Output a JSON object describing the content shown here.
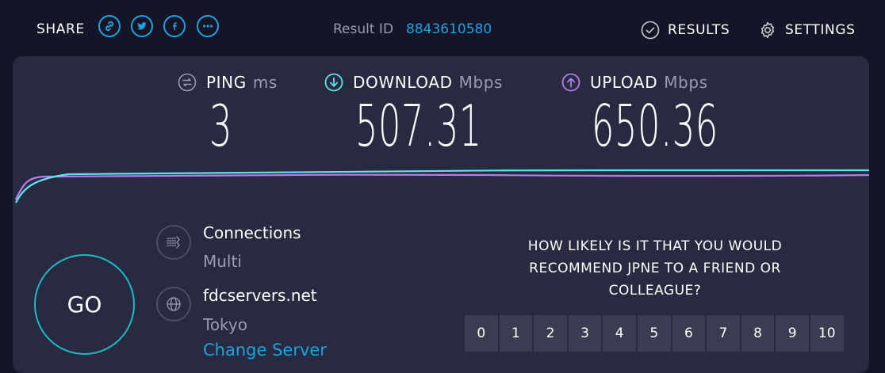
{
  "header": {
    "share_label": "SHARE",
    "share_icons": [
      "link-icon",
      "twitter-icon",
      "facebook-icon",
      "more-icon"
    ],
    "result_label": "Result ID",
    "result_id": "8843610580",
    "results_label": "RESULTS",
    "settings_label": "SETTINGS"
  },
  "metrics": {
    "ping": {
      "label": "PING",
      "unit": "ms",
      "value": "3"
    },
    "download": {
      "label": "DOWNLOAD",
      "unit": "Mbps",
      "value": "507.31"
    },
    "upload": {
      "label": "UPLOAD",
      "unit": "Mbps",
      "value": "650.36"
    }
  },
  "go_label": "GO",
  "connections": {
    "title": "Connections",
    "value": "Multi"
  },
  "server": {
    "title": "fdcservers.net",
    "location": "Tokyo",
    "change_label": "Change Server"
  },
  "survey": {
    "question": "HOW LIKELY IS IT THAT YOU WOULD RECOMMEND JPNE TO A FRIEND OR COLLEAGUE?",
    "scale": [
      "0",
      "1",
      "2",
      "3",
      "4",
      "5",
      "6",
      "7",
      "8",
      "9",
      "10"
    ]
  },
  "colors": {
    "accent": "#1fa2e0",
    "download": "#5ee4e4",
    "upload": "#b57af0",
    "background": "#141526",
    "panel": "#272a40"
  }
}
